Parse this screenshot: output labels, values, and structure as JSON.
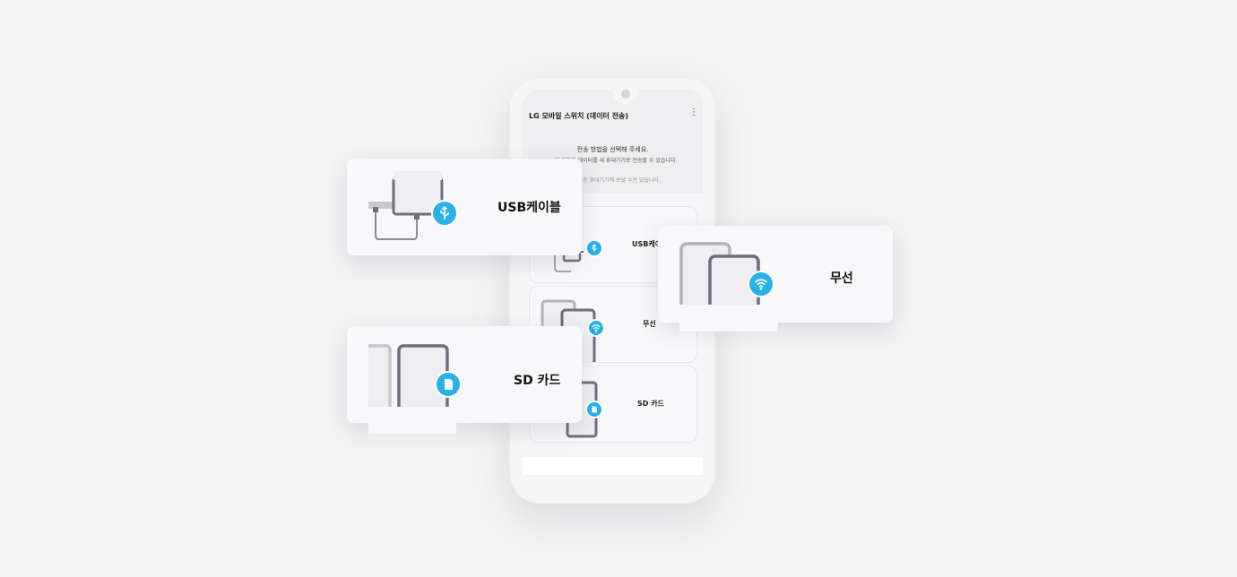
{
  "app": {
    "title": "LG 모바일 스위치 (데이터 전송)",
    "more_icon": "more-vert-icon"
  },
  "instructions": {
    "main": "전송 방법을 선택해 주세요.",
    "sub": "에 저장된 데이터를 새 휴대기기로 전송할 수 있습니다.",
    "note": "를 다른 휴대기기에 보낼 수만 있습니다."
  },
  "options": [
    {
      "label": "USB케이블",
      "icon": "usb-icon"
    },
    {
      "label": "무선",
      "icon": "wifi-icon"
    },
    {
      "label": "SD 카드",
      "icon": "sd-card-icon"
    }
  ],
  "screen_labels": {
    "usb": "USB케이",
    "wireless": "무선",
    "sd": "SD 카드"
  },
  "colors": {
    "accent": "#29b1e8",
    "device_dark": "#6c6f7d",
    "device_light": "#b3b4ba",
    "background": "#f3f3f4"
  }
}
